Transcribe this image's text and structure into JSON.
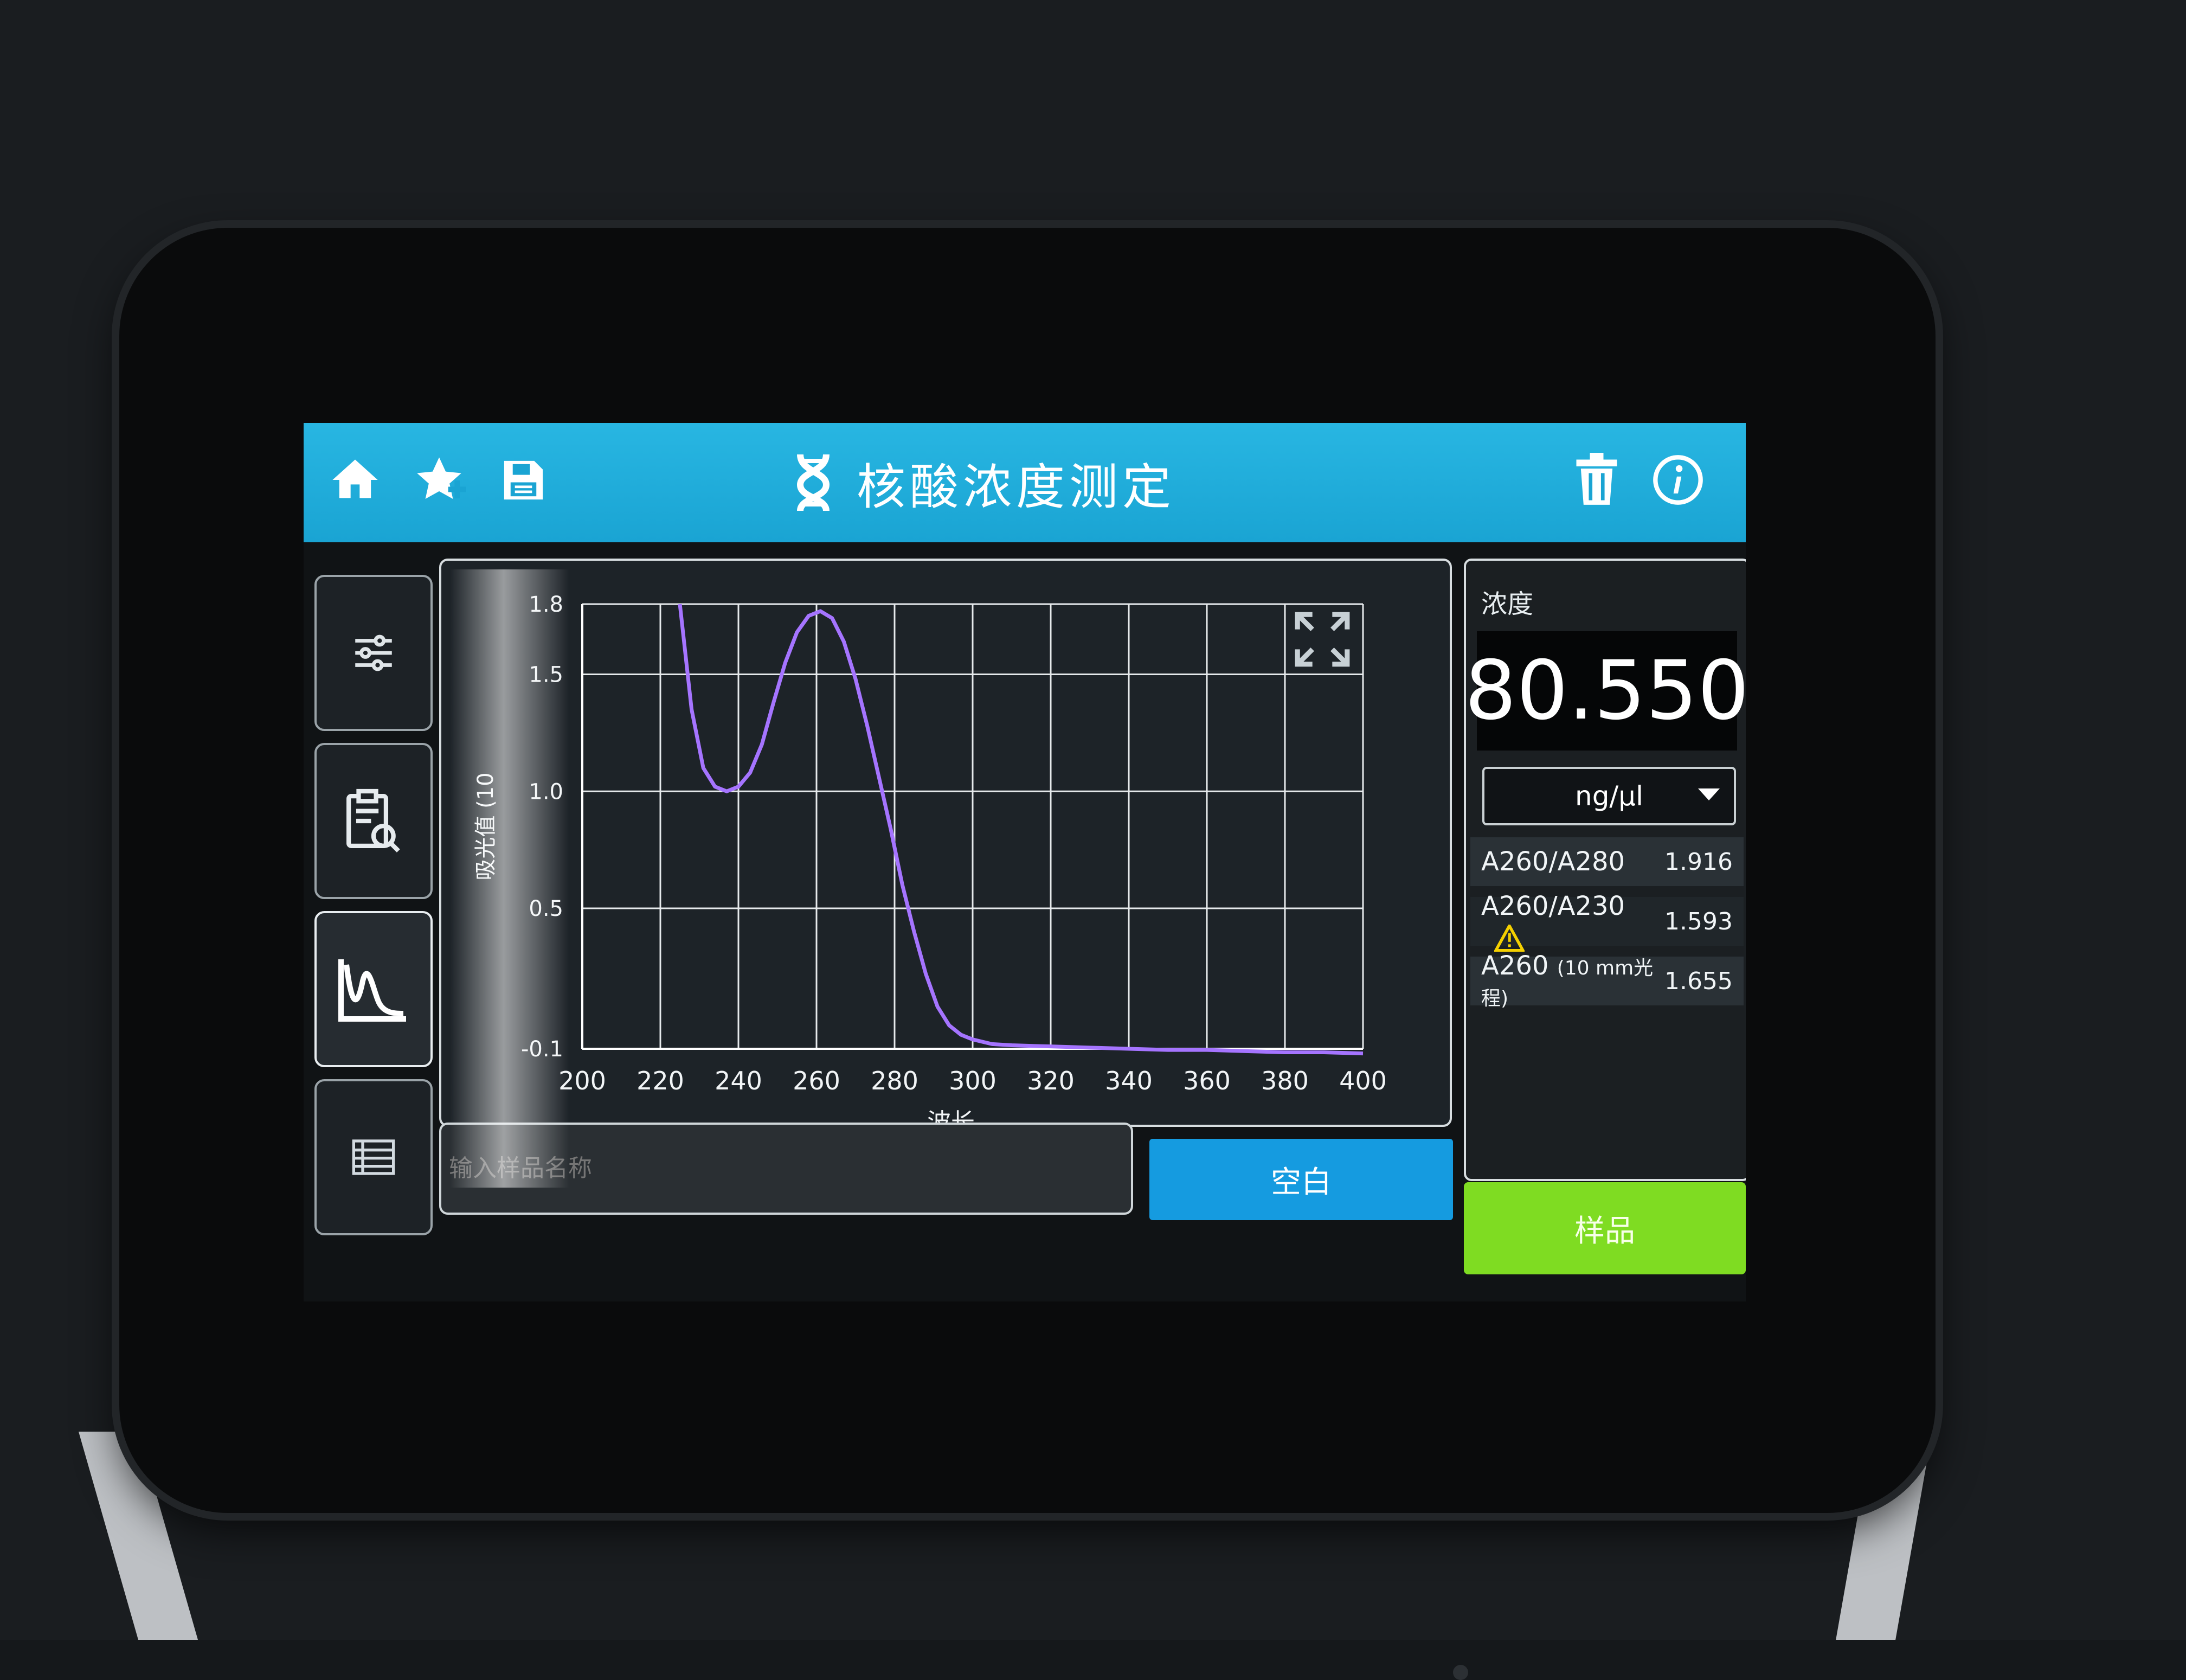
{
  "app": {
    "title": "核酸浓度测定"
  },
  "toolbar": {
    "home_icon": "home-icon",
    "favorite_icon": "star-add-icon",
    "save_icon": "save-icon",
    "delete_icon": "trash-icon",
    "info_icon": "info-icon"
  },
  "sidenav": {
    "items": [
      {
        "icon": "settings-sliders-icon"
      },
      {
        "icon": "clipboard-search-icon"
      },
      {
        "icon": "spectrum-chart-icon"
      },
      {
        "icon": "table-list-icon"
      }
    ],
    "active_index": 2
  },
  "chart_data": {
    "type": "line",
    "title": "",
    "xlabel": "波长",
    "ylabel": "吸光值 (10",
    "xlim": [
      200,
      400
    ],
    "ylim": [
      -0.1,
      1.8
    ],
    "x_ticks": [
      "200",
      "220",
      "240",
      "260",
      "280",
      "300",
      "320",
      "340",
      "360",
      "380",
      "400"
    ],
    "y_ticks": [
      "-0.1",
      "0.5",
      "1.0",
      "1.5",
      "1.8"
    ],
    "grid": true,
    "series": [
      {
        "color": "#a574ff",
        "x": [
          225,
          228,
          231,
          234,
          237,
          240,
          243,
          246,
          249,
          252,
          255,
          258,
          261,
          264,
          267,
          270,
          273,
          276,
          279,
          282,
          285,
          288,
          291,
          294,
          297,
          300,
          305,
          310,
          320,
          330,
          340,
          350,
          360,
          370,
          380,
          390,
          400
        ],
        "y": [
          1.8,
          1.35,
          1.1,
          1.02,
          1.0,
          1.02,
          1.08,
          1.2,
          1.38,
          1.55,
          1.68,
          1.75,
          1.77,
          1.74,
          1.64,
          1.48,
          1.28,
          1.06,
          0.84,
          0.6,
          0.4,
          0.22,
          0.08,
          0.0,
          -0.04,
          -0.06,
          -0.08,
          -0.085,
          -0.09,
          -0.095,
          -0.1,
          -0.105,
          -0.105,
          -0.11,
          -0.115,
          -0.115,
          -0.12
        ]
      }
    ]
  },
  "readout": {
    "label": "浓度",
    "value": "80.550",
    "unit": "ng/µl",
    "ratios": [
      {
        "label": "A260/A280",
        "value": "1.916"
      },
      {
        "label": "A260/A230",
        "value": "1.593",
        "warning": true
      },
      {
        "label": "A260",
        "label_small": "(10 mm光程)",
        "value": "1.655"
      }
    ]
  },
  "input": {
    "placeholder": "输入样品名称"
  },
  "buttons": {
    "blank": "空白",
    "sample": "样品"
  },
  "colors": {
    "topbar": "#1aa4d3",
    "blank_button": "#159be0",
    "sample_button": "#7fdc22",
    "warning": "#f5d000",
    "curve": "#a574ff"
  }
}
